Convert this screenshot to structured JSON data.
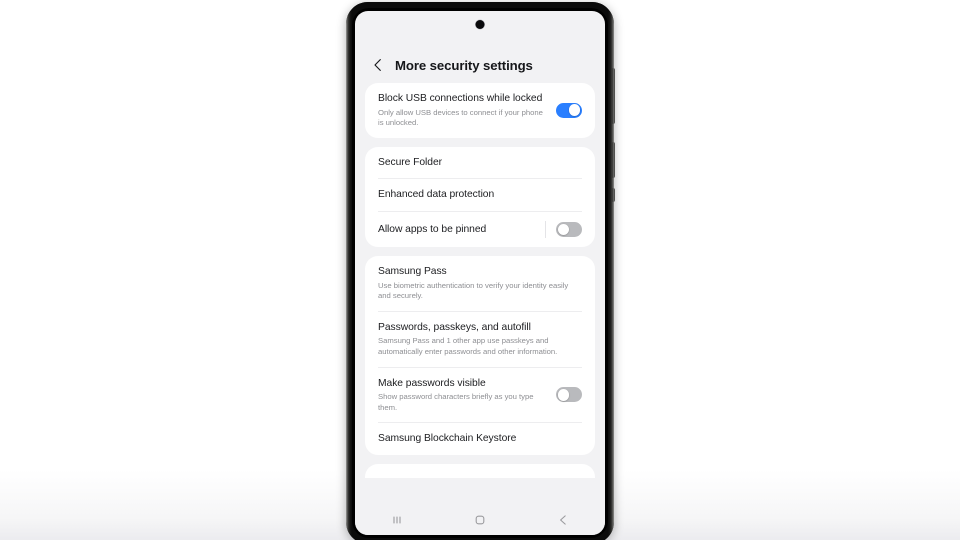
{
  "app": {
    "title": "More security settings",
    "back_icon": "back-chevron-icon"
  },
  "colors": {
    "toggle_on": "#2a7fff",
    "toggle_off": "#b9babd",
    "screen_bg": "#f2f2f4",
    "card_bg": "#ffffff",
    "title_text": "#1c1d20",
    "subtitle_text": "#8e8f93"
  },
  "sections": [
    {
      "id": "usb",
      "rows": [
        {
          "name": "block-usb-connections",
          "title": "Block USB connections while locked",
          "subtitle": "Only allow USB devices to connect if your phone is unlocked.",
          "toggle": "on",
          "toggle_divider": false
        }
      ]
    },
    {
      "id": "folder",
      "rows": [
        {
          "name": "secure-folder",
          "title": "Secure Folder",
          "subtitle": "",
          "toggle": "none",
          "toggle_divider": false
        },
        {
          "name": "enhanced-data-protection",
          "title": "Enhanced data protection",
          "subtitle": "",
          "toggle": "none",
          "toggle_divider": false
        },
        {
          "name": "allow-apps-to-be-pinned",
          "title": "Allow apps to be pinned",
          "subtitle": "",
          "toggle": "off",
          "toggle_divider": true
        }
      ]
    },
    {
      "id": "pass",
      "rows": [
        {
          "name": "samsung-pass",
          "title": "Samsung Pass",
          "subtitle": "Use biometric authentication to verify your identity easily and securely.",
          "toggle": "none",
          "toggle_divider": false
        },
        {
          "name": "passwords-passkeys-autofill",
          "title": "Passwords, passkeys, and autofill",
          "subtitle": "Samsung Pass and 1 other app use passkeys and automatically enter passwords and other information.",
          "toggle": "none",
          "toggle_divider": false
        },
        {
          "name": "make-passwords-visible",
          "title": "Make passwords visible",
          "subtitle": "Show password characters briefly as you type them.",
          "toggle": "off",
          "toggle_divider": false
        },
        {
          "name": "samsung-blockchain-keystore",
          "title": "Samsung Blockchain Keystore",
          "subtitle": "",
          "toggle": "none",
          "toggle_divider": false
        }
      ]
    }
  ],
  "nav_bar": {
    "recents_icon": "recents-icon",
    "home_icon": "home-icon",
    "back_icon": "back-icon"
  }
}
